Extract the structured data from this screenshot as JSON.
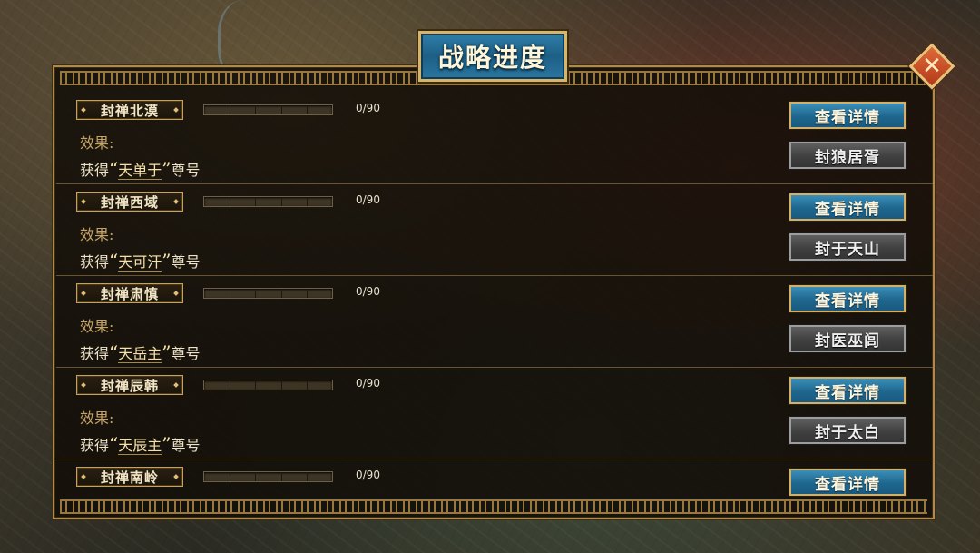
{
  "title": "战略进度",
  "effect_label": "效果:",
  "details_label": "查看详情",
  "quests": [
    {
      "name": "封禅北漠",
      "progress_text": "0/90",
      "progress_fraction": 0,
      "effect_prefix": "获得",
      "effect_title": "天单于",
      "effect_suffix": "尊号",
      "action_label": "封狼居胥"
    },
    {
      "name": "封禅西域",
      "progress_text": "0/90",
      "progress_fraction": 0,
      "effect_prefix": "获得",
      "effect_title": "天可汗",
      "effect_suffix": "尊号",
      "action_label": "封于天山"
    },
    {
      "name": "封禅肃慎",
      "progress_text": "0/90",
      "progress_fraction": 0,
      "effect_prefix": "获得",
      "effect_title": "天岳主",
      "effect_suffix": "尊号",
      "action_label": "封医巫闾"
    },
    {
      "name": "封禅辰韩",
      "progress_text": "0/90",
      "progress_fraction": 0,
      "effect_prefix": "获得",
      "effect_title": "天辰主",
      "effect_suffix": "尊号",
      "action_label": "封于太白"
    },
    {
      "name": "封禅南岭",
      "progress_text": "0/90",
      "progress_fraction": 0
    }
  ]
}
